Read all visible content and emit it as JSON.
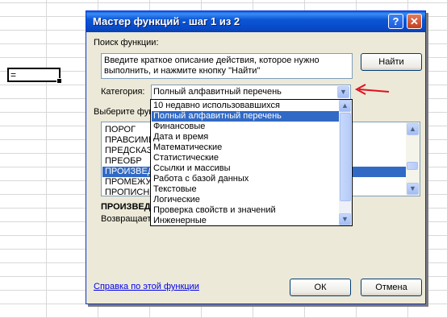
{
  "sheet": {
    "active_cell_value": "="
  },
  "dialog": {
    "title": "Мастер функций - шаг 1 из 2",
    "help_button_label": "?",
    "close_button_label": "✕",
    "search": {
      "label": "Поиск функции:",
      "description": "Введите краткое описание действия, которое нужно выполнить, и нажмите кнопку \"Найти\"",
      "find_button": "Найти"
    },
    "category": {
      "label": "Категория:",
      "selected": "Полный алфавитный перечень",
      "options": [
        "10 недавно использовавшихся",
        "Полный алфавитный перечень",
        "Финансовые",
        "Дата и время",
        "Математические",
        "Статистические",
        "Ссылки и массивы",
        "Работа с базой данных",
        "Текстовые",
        "Логические",
        "Проверка свойств и значений",
        "Инженерные"
      ]
    },
    "function_list": {
      "label": "Выберите фун",
      "items": [
        "ПОРОГ",
        "ПРАВСИМВ",
        "ПРЕДСКАЗ",
        "ПРЕОБР",
        "ПРОИЗВЕД",
        "ПРОМЕЖУТ",
        "ПРОПИСН"
      ],
      "selected_index": 4
    },
    "selected_function_name": "ПРОИЗВЕД",
    "returns_text": "Возвращает",
    "help_link": "Справка по этой функции",
    "ok_button": "ОК",
    "cancel_button": "Отмена"
  },
  "colors": {
    "annotation_arrow": "#e0101e",
    "selection": "#316ac5",
    "titlebar": "#0848c4"
  }
}
